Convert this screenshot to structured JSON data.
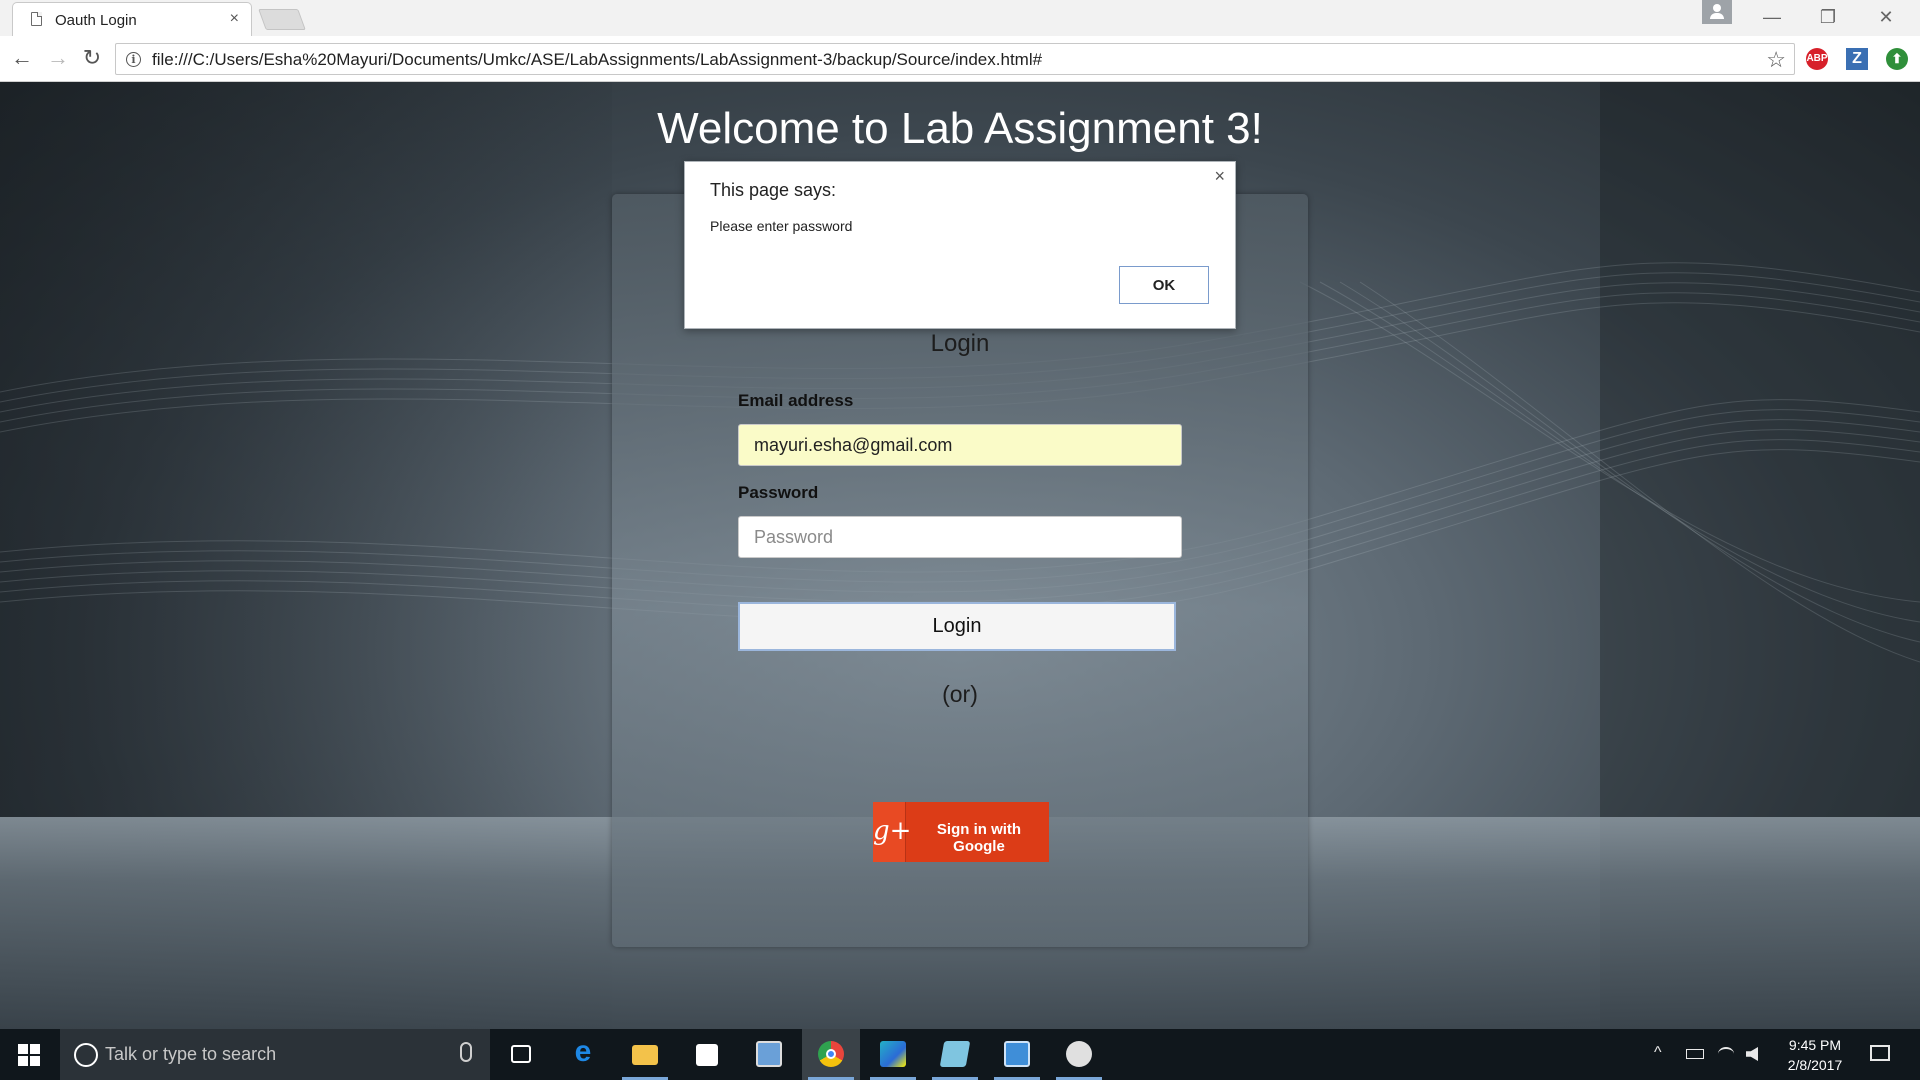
{
  "browser": {
    "tab_title": "Oauth Login",
    "tab_close": "×",
    "url": "file:///C:/Users/Esha%20Mayuri/Documents/Umkc/ASE/LabAssignments/LabAssignment-3/backup/Source/index.html#",
    "back": "←",
    "forward": "→",
    "reload": "↻",
    "star": "☆",
    "minimize": "—",
    "restore": "❐",
    "close": "✕",
    "extensions": [
      {
        "name": "adblock-plus-icon",
        "label": "ABP",
        "color": "#d7202a"
      },
      {
        "name": "zotero-icon",
        "label": "Z",
        "color": "#3a6fb3"
      },
      {
        "name": "download-extension-icon",
        "label": "⬆",
        "color": "#2f8f3a"
      }
    ]
  },
  "page": {
    "heading": "Welcome to Lab Assignment 3!",
    "login_title": "Login",
    "email_label": "Email address",
    "email_value": "mayuri.esha@gmail.com",
    "password_label": "Password",
    "password_placeholder": "Password",
    "login_button": "Login",
    "or_text": "(or)",
    "google_icon": "g+",
    "google_button": "Sign in with Google"
  },
  "dialog": {
    "title": "This page says:",
    "message": "Please enter password",
    "ok_label": "OK",
    "close": "×"
  },
  "taskbar": {
    "search_placeholder": "Talk or type to search",
    "apps": [
      {
        "name": "task-view-icon",
        "color": "#ffffff"
      },
      {
        "name": "edge-icon",
        "color": "#1e88e5"
      },
      {
        "name": "file-explorer-icon",
        "color": "#f3c24a"
      },
      {
        "name": "store-icon",
        "color": "#ffffff"
      },
      {
        "name": "remote-desktop-icon",
        "color": "#6aa0d8"
      },
      {
        "name": "chrome-icon",
        "color": "#e8453c"
      },
      {
        "name": "webstorm-icon",
        "color": "#23b1c6"
      },
      {
        "name": "notepad-icon",
        "color": "#7fc5e0"
      },
      {
        "name": "outlook-icon",
        "color": "#3f8ed8"
      },
      {
        "name": "paint-icon",
        "color": "#e0e0e0"
      }
    ],
    "time": "9:45 PM",
    "date": "2/8/2017",
    "tray_up": "^"
  }
}
